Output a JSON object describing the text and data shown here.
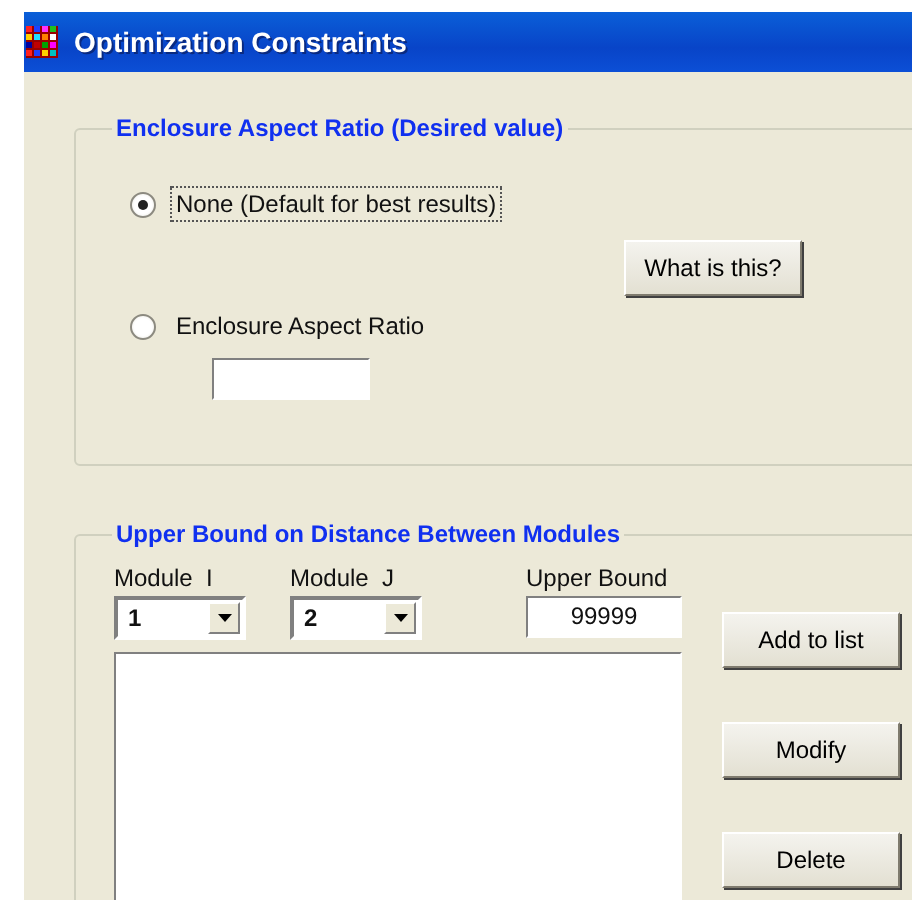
{
  "window": {
    "title": "Optimization Constraints"
  },
  "aspect_group": {
    "title": "Enclosure Aspect Ratio (Desired value)",
    "options": [
      {
        "label": "None (Default for best results)",
        "selected": true,
        "focused": true
      },
      {
        "label": "Enclosure Aspect Ratio",
        "selected": false,
        "focused": false
      }
    ],
    "help_button": "What is this?"
  },
  "distance_group": {
    "title": "Upper Bound on Distance Between Modules",
    "module_i": {
      "label": "Module  I",
      "value": "1"
    },
    "module_j": {
      "label": "Module  J",
      "value": "2"
    },
    "upper_bound": {
      "label": "Upper Bound",
      "value": "99999"
    },
    "buttons": [
      "Add to list",
      "Modify",
      "Delete"
    ]
  }
}
